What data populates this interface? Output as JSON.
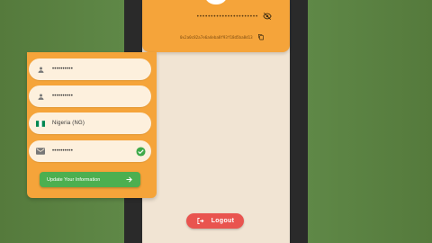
{
  "profile": {
    "password_mask": "••••••••••••••••••••••",
    "wallet_hash": "0x2a0c82a7e6a4eba8f93f18d5ba8d13"
  },
  "form": {
    "field1_value": "••••••••••",
    "field2_value": "••••••••••",
    "country_value": "Nigeria (NG)",
    "field4_value": "••••••••••",
    "update_label": "Update Your Information"
  },
  "logout": {
    "label": "Logout"
  },
  "colors": {
    "primary_orange": "#f5a43a",
    "field_bg": "#fdf0dd",
    "update_green": "#4caf50",
    "logout_red": "#e9544f",
    "background_green": "#5a8042"
  },
  "icons": [
    "eye-off-icon",
    "copy-icon",
    "person-icon",
    "nigeria-flag-icon",
    "email-icon",
    "check-circle-icon",
    "arrow-right-icon",
    "logout-icon"
  ]
}
